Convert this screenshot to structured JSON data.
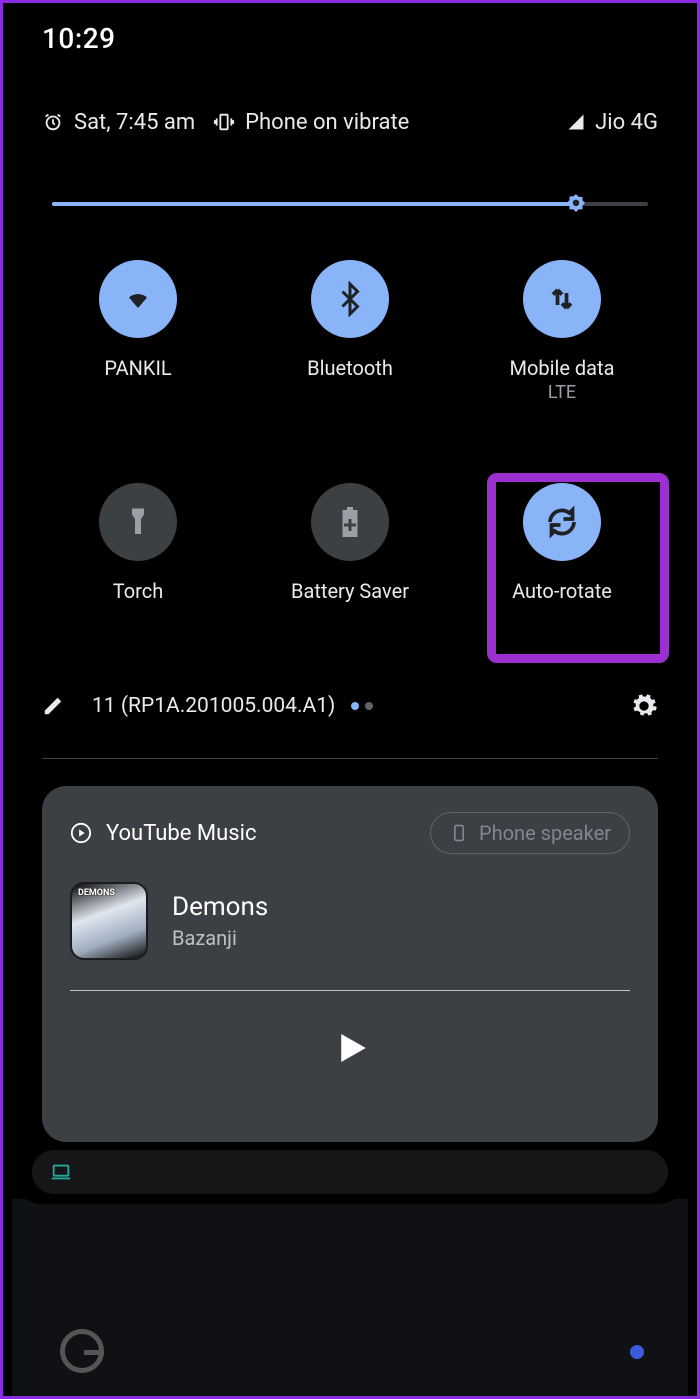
{
  "status": {
    "time": "10:29",
    "alarm_text": "Sat, 7:45 am",
    "ringer_text": "Phone on vibrate",
    "carrier": "Jio 4G"
  },
  "brightness": {
    "percent": 88
  },
  "tiles": [
    {
      "name": "wifi",
      "label": "PANKIL",
      "sublabel": "",
      "on": true
    },
    {
      "name": "bluetooth",
      "label": "Bluetooth",
      "sublabel": "",
      "on": true
    },
    {
      "name": "mobile-data",
      "label": "Mobile data",
      "sublabel": "LTE",
      "on": true
    },
    {
      "name": "torch",
      "label": "Torch",
      "sublabel": "",
      "on": false
    },
    {
      "name": "battery-saver",
      "label": "Battery Saver",
      "sublabel": "",
      "on": false
    },
    {
      "name": "auto-rotate",
      "label": "Auto-rotate",
      "sublabel": "",
      "on": true,
      "highlighted": true
    }
  ],
  "footer": {
    "build_text": "11 (RP1A.201005.004.A1)",
    "page_index": 0,
    "page_count": 2
  },
  "media": {
    "app_name": "YouTube Music",
    "output_label": "Phone speaker",
    "album_badge": "DEMONS",
    "track_title": "Demons",
    "track_artist": "Bazanji",
    "playing": false
  },
  "icons": {
    "alarm": "alarm-icon",
    "vibrate": "vibrate-icon",
    "signal": "signal-icon",
    "edit": "edit-icon",
    "gear": "gear-icon",
    "play": "play-icon",
    "laptop": "laptop-icon",
    "phone": "phone-icon"
  }
}
